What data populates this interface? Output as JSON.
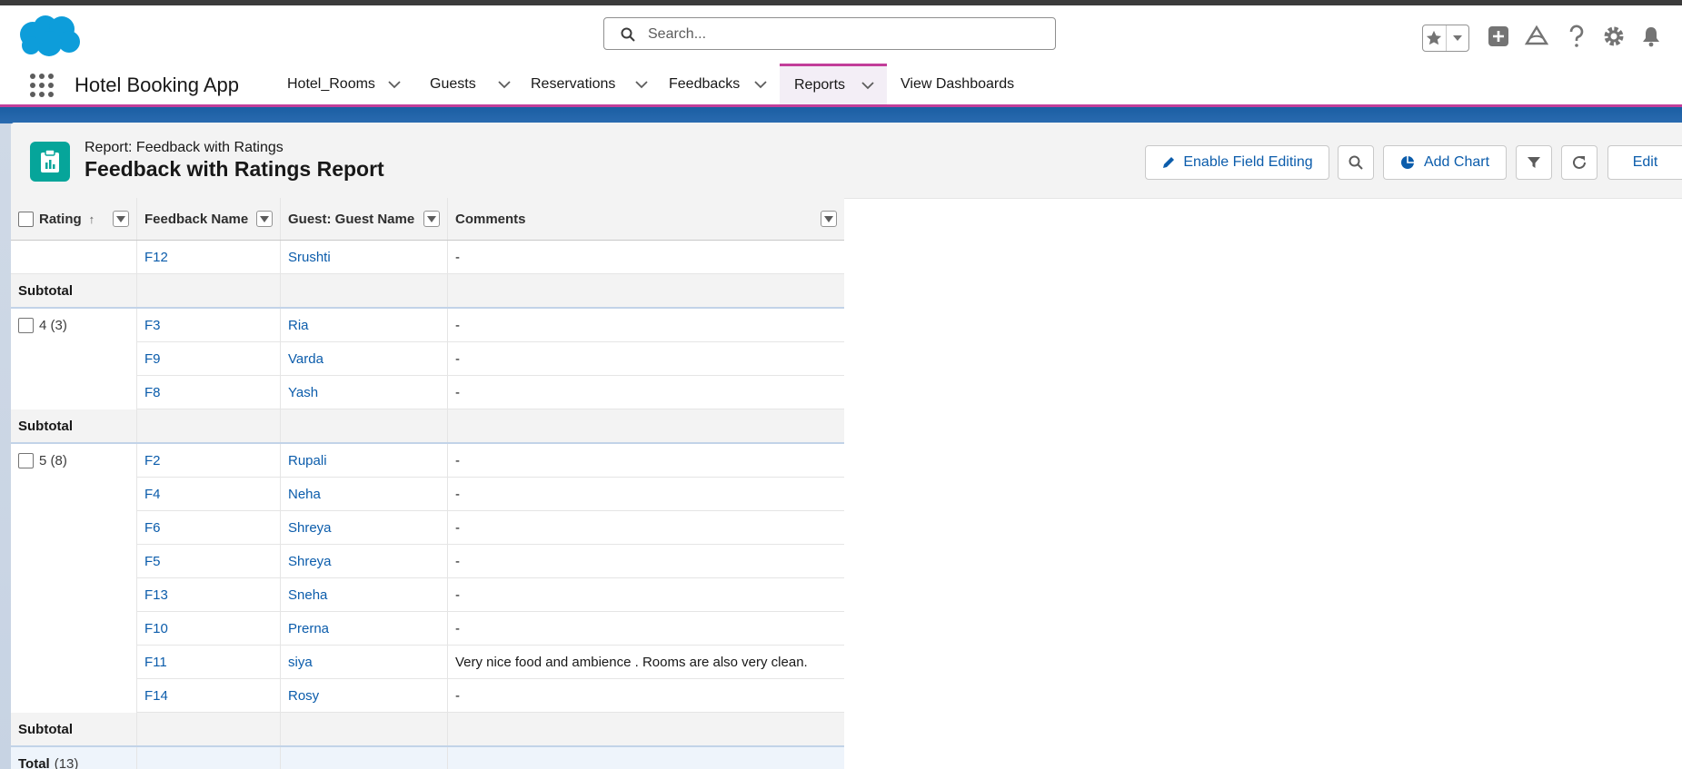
{
  "header": {
    "search_placeholder": "Search...",
    "icons": [
      "star-icon",
      "chevron-down-icon",
      "plus-icon",
      "trailhead-icon",
      "help-icon",
      "gear-icon",
      "bell-icon"
    ]
  },
  "nav": {
    "app_name": "Hotel Booking App",
    "tabs": [
      {
        "label": "Hotel_Rooms",
        "has_menu": true
      },
      {
        "label": "Guests",
        "has_menu": true
      },
      {
        "label": "Reservations",
        "has_menu": true
      },
      {
        "label": "Feedbacks",
        "has_menu": true
      },
      {
        "label": "Reports",
        "has_menu": true,
        "active": true
      },
      {
        "label": "View Dashboards",
        "has_menu": false
      }
    ]
  },
  "report": {
    "kicker": "Report: Feedback with Ratings",
    "title": "Feedback with Ratings Report",
    "buttons": {
      "enable_field_editing": "Enable Field Editing",
      "add_chart": "Add Chart",
      "edit": "Edit"
    }
  },
  "table": {
    "columns": [
      "Rating",
      "Feedback Name",
      "Guest: Guest Name",
      "Comments"
    ],
    "subtotal_label": "Subtotal",
    "total_label": "Total",
    "total_count": "(13)",
    "groups": [
      {
        "label": "",
        "rows": [
          {
            "name": "F12",
            "guest": "Srushti",
            "comment": "-"
          }
        ]
      },
      {
        "label": "4 (3)",
        "rows": [
          {
            "name": "F3",
            "guest": "Ria",
            "comment": "-"
          },
          {
            "name": "F9",
            "guest": "Varda",
            "comment": "-"
          },
          {
            "name": "F8",
            "guest": "Yash",
            "comment": "-"
          }
        ]
      },
      {
        "label": "5 (8)",
        "rows": [
          {
            "name": "F2",
            "guest": "Rupali",
            "comment": "-"
          },
          {
            "name": "F4",
            "guest": "Neha",
            "comment": "-"
          },
          {
            "name": "F6",
            "guest": "Shreya",
            "comment": "-"
          },
          {
            "name": "F5",
            "guest": "Shreya",
            "comment": "-"
          },
          {
            "name": "F13",
            "guest": "Sneha",
            "comment": "-"
          },
          {
            "name": "F10",
            "guest": "Prerna",
            "comment": "-"
          },
          {
            "name": "F11",
            "guest": "siya",
            "comment": "Very nice food and ambience . Rooms are also very clean."
          },
          {
            "name": "F14",
            "guest": "Rosy",
            "comment": "-"
          }
        ]
      }
    ]
  }
}
